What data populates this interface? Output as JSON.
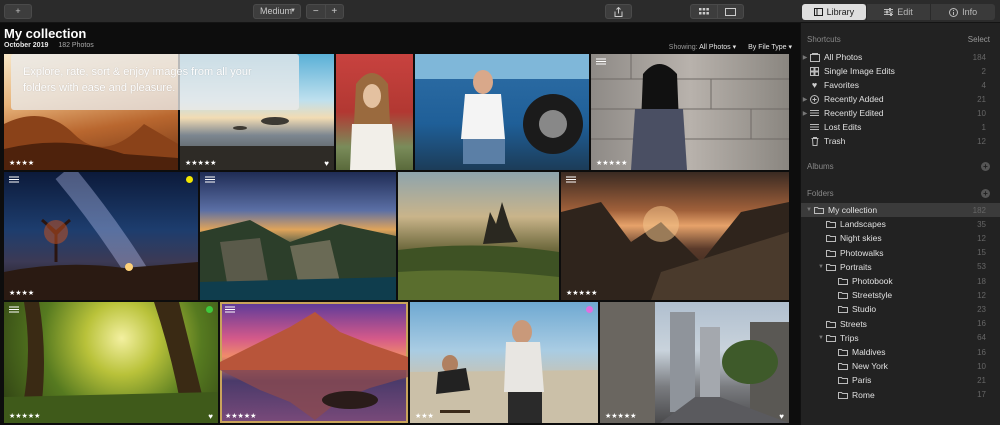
{
  "toolbar": {
    "add_label": "+",
    "size_label": "Medium",
    "zoom_out": "−",
    "zoom_in": "+",
    "tabs": [
      {
        "label": "Library",
        "icon": "library-icon",
        "active": true
      },
      {
        "label": "Edit",
        "icon": "sliders-icon",
        "active": false
      },
      {
        "label": "Info",
        "icon": "info-icon",
        "active": false
      }
    ]
  },
  "header": {
    "title": "My collection",
    "date": "October 2019",
    "count": "182 Photos",
    "showing_label": "Showing:",
    "showing_value": "All Photos",
    "sort_value": "By File Type"
  },
  "intro": {
    "text": "Explore, rate, sort & enjoy images from all your folders with ease and pleasure."
  },
  "photos": [
    {
      "stars": "★★★★",
      "heart": "",
      "edit": false,
      "dot": ""
    },
    {
      "stars": "★★★★★",
      "heart": "♥",
      "edit": false,
      "dot": ""
    },
    {
      "stars": "",
      "heart": "",
      "edit": false,
      "dot": ""
    },
    {
      "stars": "",
      "heart": "",
      "edit": false,
      "dot": ""
    },
    {
      "stars": "★★★★★",
      "heart": "",
      "edit": true,
      "dot": ""
    },
    {
      "stars": "★★★★",
      "heart": "",
      "edit": true,
      "dot": "#f2e600"
    },
    {
      "stars": "",
      "heart": "",
      "edit": true,
      "dot": ""
    },
    {
      "stars": "",
      "heart": "",
      "edit": false,
      "dot": ""
    },
    {
      "stars": "★★★★★",
      "heart": "",
      "edit": true,
      "dot": ""
    },
    {
      "stars": "★★★★★",
      "heart": "♥",
      "edit": true,
      "dot": "#3ec93e"
    },
    {
      "stars": "★★★★★",
      "heart": "",
      "edit": true,
      "dot": ""
    },
    {
      "stars": "★★★",
      "heart": "",
      "edit": false,
      "dot": "#e070e0"
    },
    {
      "stars": "★★★★★",
      "heart": "♥",
      "edit": false,
      "dot": ""
    }
  ],
  "sidebar": {
    "shortcuts_title": "Shortcuts",
    "select_label": "Select",
    "shortcuts": [
      {
        "label": "All Photos",
        "count": "184",
        "icon": "photos-icon",
        "arrow": "▶"
      },
      {
        "label": "Single Image Edits",
        "count": "2",
        "icon": "grid-icon",
        "arrow": ""
      },
      {
        "label": "Favorites",
        "count": "4",
        "icon": "heart-icon",
        "arrow": ""
      },
      {
        "label": "Recently Added",
        "count": "21",
        "icon": "plus-circle-icon",
        "arrow": "▶"
      },
      {
        "label": "Recently Edited",
        "count": "10",
        "icon": "sliders-icon",
        "arrow": "▶"
      },
      {
        "label": "Lost Edits",
        "count": "1",
        "icon": "sliders-icon",
        "arrow": ""
      },
      {
        "label": "Trash",
        "count": "12",
        "icon": "trash-icon",
        "arrow": ""
      }
    ],
    "albums_title": "Albums",
    "folders_title": "Folders",
    "folders": [
      {
        "label": "My collection",
        "count": "182",
        "level": 0,
        "arrow": "▼",
        "selected": true
      },
      {
        "label": "Landscapes",
        "count": "35",
        "level": 1,
        "arrow": "",
        "selected": false
      },
      {
        "label": "Night skies",
        "count": "12",
        "level": 1,
        "arrow": "",
        "selected": false
      },
      {
        "label": "Photowalks",
        "count": "15",
        "level": 1,
        "arrow": "",
        "selected": false
      },
      {
        "label": "Portraits",
        "count": "53",
        "level": 1,
        "arrow": "▼",
        "selected": false
      },
      {
        "label": "Photobook",
        "count": "18",
        "level": 2,
        "arrow": "",
        "selected": false
      },
      {
        "label": "Streetstyle",
        "count": "12",
        "level": 2,
        "arrow": "",
        "selected": false
      },
      {
        "label": "Studio",
        "count": "23",
        "level": 2,
        "arrow": "",
        "selected": false
      },
      {
        "label": "Streets",
        "count": "16",
        "level": 1,
        "arrow": "",
        "selected": false
      },
      {
        "label": "Trips",
        "count": "64",
        "level": 1,
        "arrow": "▼",
        "selected": false
      },
      {
        "label": "Maldives",
        "count": "16",
        "level": 2,
        "arrow": "",
        "selected": false
      },
      {
        "label": "New York",
        "count": "10",
        "level": 2,
        "arrow": "",
        "selected": false
      },
      {
        "label": "Paris",
        "count": "21",
        "level": 2,
        "arrow": "",
        "selected": false
      },
      {
        "label": "Rome",
        "count": "17",
        "level": 2,
        "arrow": "",
        "selected": false
      }
    ]
  },
  "colors": {
    "accent_selected": "#c9a45b",
    "sidebar_bg": "#222222",
    "grid_bg": "#0d0d0d"
  }
}
